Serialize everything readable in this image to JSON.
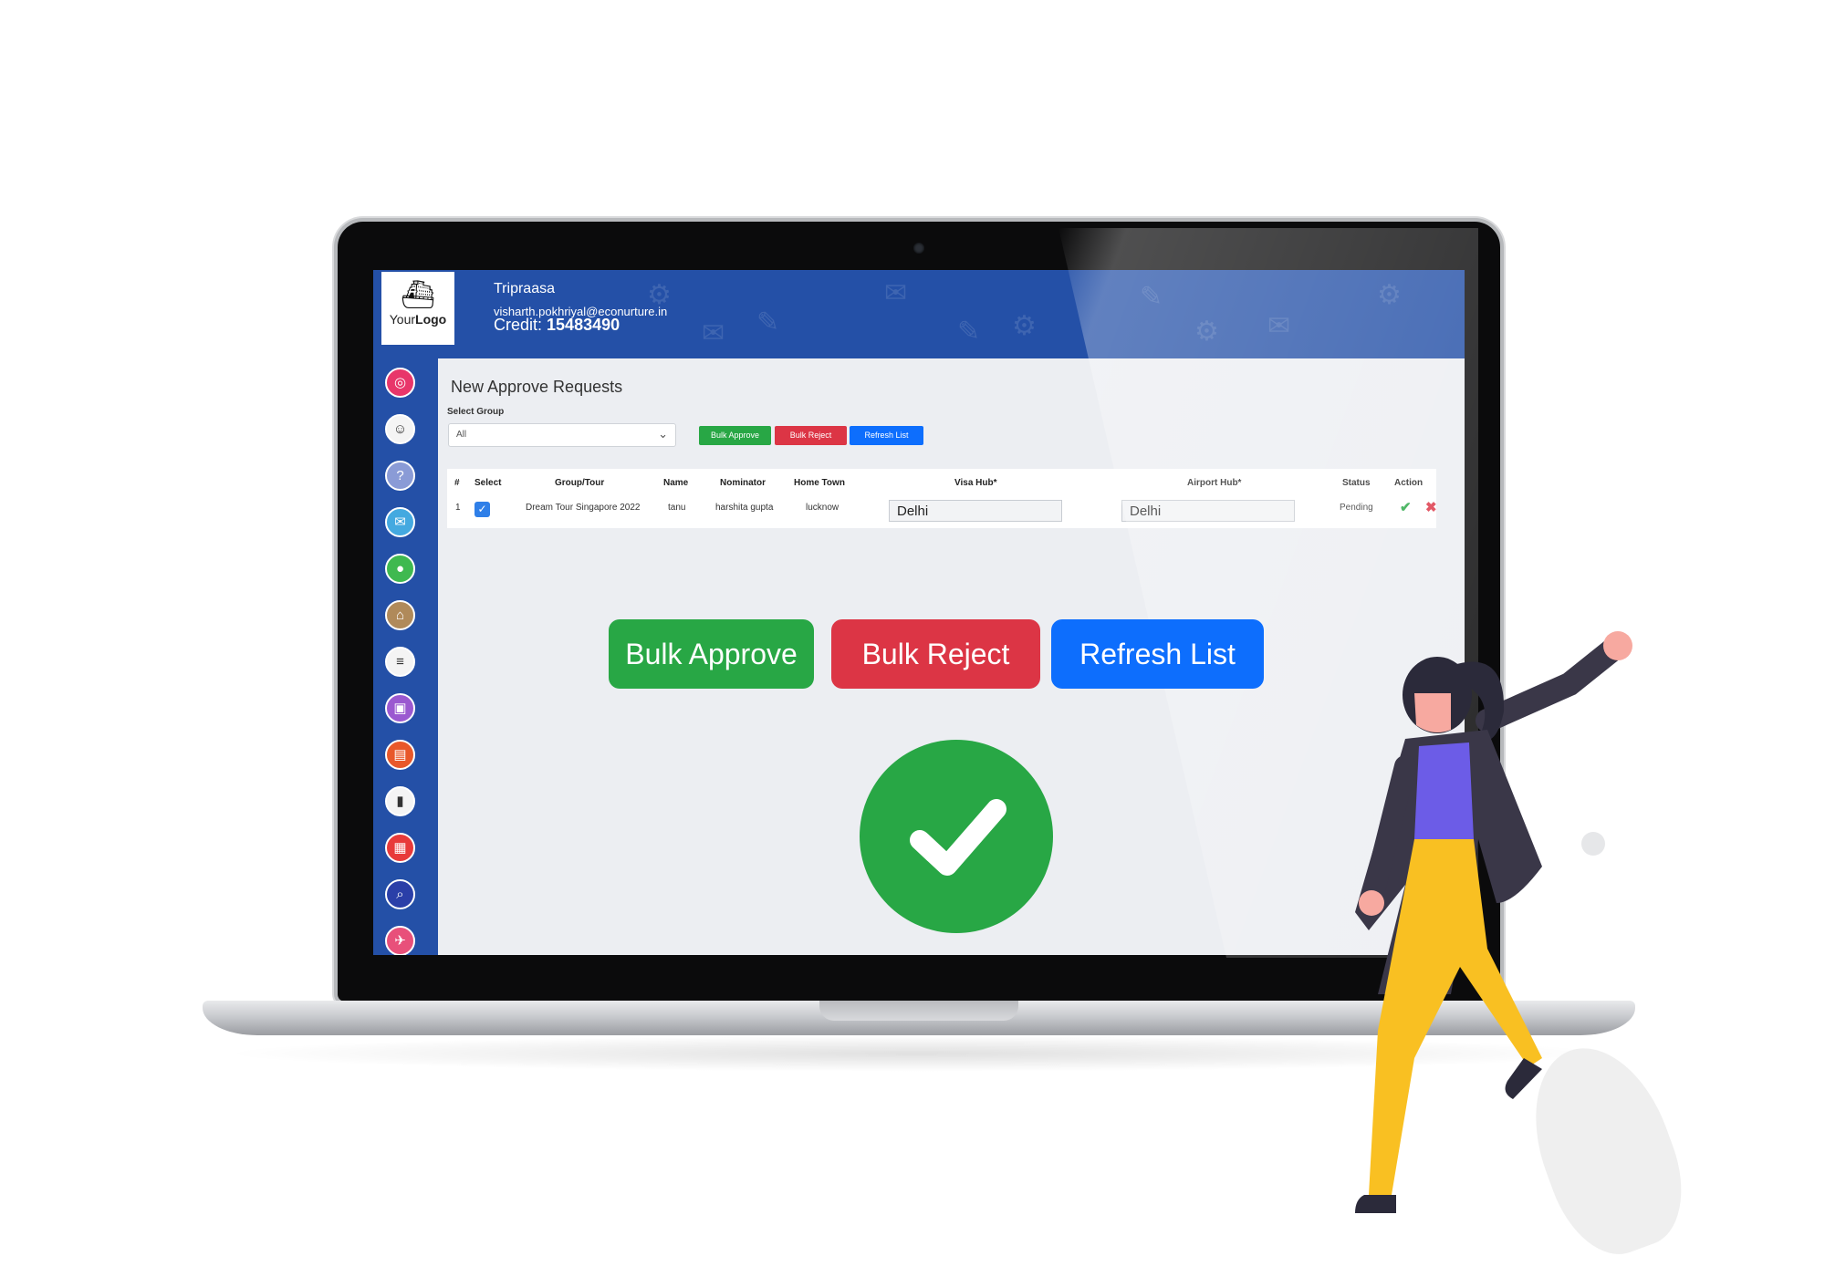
{
  "header": {
    "logo_text_light": "Your",
    "logo_text_bold": "Logo",
    "user_name": "Tripraasa",
    "user_email": "visharth.pokhriyal@econurture.in",
    "credit_label": "Credit:",
    "credit_value": "15483490"
  },
  "sidebar": {
    "items": [
      {
        "icon": "dashboard-icon",
        "color": "#e8366a"
      },
      {
        "icon": "user-icon",
        "color": "#ffffff"
      },
      {
        "icon": "help-icon",
        "color": "#8a9bd6"
      },
      {
        "icon": "chat-icon",
        "color": "#44a9e0"
      },
      {
        "icon": "group-icon",
        "color": "#3fb950"
      },
      {
        "icon": "hotel-icon",
        "color": "#b08a5a"
      },
      {
        "icon": "document-icon",
        "color": "#ffffff"
      },
      {
        "icon": "gift-icon",
        "color": "#9b59d0"
      },
      {
        "icon": "briefcase-icon",
        "color": "#e8582a"
      },
      {
        "icon": "mobile-icon",
        "color": "#ffffff"
      },
      {
        "icon": "calendar-icon",
        "color": "#e83a3a"
      },
      {
        "icon": "search-icon",
        "color": "#2a3fa8"
      },
      {
        "icon": "plane-icon",
        "color": "#e8507a"
      }
    ]
  },
  "main": {
    "title": "New Approve Requests",
    "select_group_label": "Select Group",
    "select_group_value": "All",
    "buttons": {
      "bulk_approve": "Bulk Approve",
      "bulk_reject": "Bulk Reject",
      "refresh_list": "Refresh List"
    },
    "table": {
      "headers": [
        "#",
        "Select",
        "Group/Tour",
        "Name",
        "Nominator",
        "Home Town",
        "Visa Hub*",
        "Airport Hub*",
        "Status",
        "Action"
      ],
      "rows": [
        {
          "index": "1",
          "selected": true,
          "group_tour": "Dream Tour Singapore 2022",
          "name": "tanu",
          "nominator": "harshita gupta",
          "home_town": "lucknow",
          "visa_hub": "Delhi",
          "airport_hub": "Delhi",
          "status": "Pending"
        }
      ]
    }
  },
  "callout": {
    "bulk_approve": "Bulk Approve",
    "bulk_reject": "Bulk Reject",
    "refresh_list": "Refresh List"
  },
  "colors": {
    "header_blue": "#2450a7",
    "approve_green": "#28a745",
    "reject_red": "#dc3545",
    "refresh_blue": "#0d6efd"
  }
}
